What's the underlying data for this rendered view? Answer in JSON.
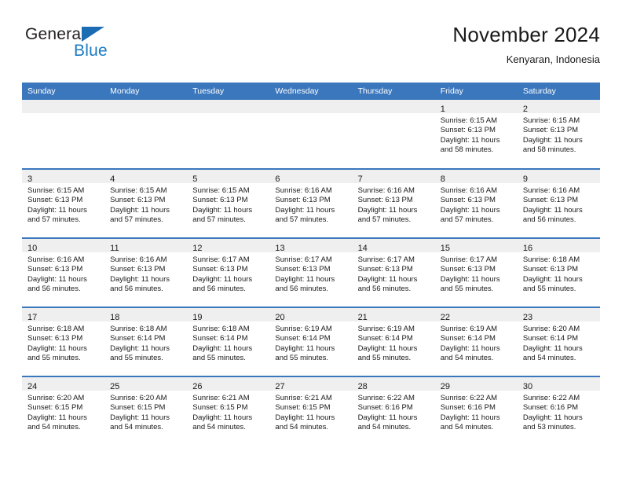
{
  "logo": {
    "word_one": "General",
    "word_two": "Blue",
    "triangle_color": "#1b6cb3",
    "blue_color": "#1b7ac4"
  },
  "header": {
    "title": "November 2024",
    "subtitle": "Kenyaran, Indonesia",
    "accent_color": "#3a77bd",
    "band_color": "#efeff0"
  },
  "calendar": {
    "weekday_headers": [
      "Sunday",
      "Monday",
      "Tuesday",
      "Wednesday",
      "Thursday",
      "Friday",
      "Saturday"
    ],
    "weeks": [
      [
        {
          "day": "",
          "sunrise": "",
          "sunset": "",
          "daylight_1": "",
          "daylight_2": "",
          "empty": true
        },
        {
          "day": "",
          "sunrise": "",
          "sunset": "",
          "daylight_1": "",
          "daylight_2": "",
          "empty": true
        },
        {
          "day": "",
          "sunrise": "",
          "sunset": "",
          "daylight_1": "",
          "daylight_2": "",
          "empty": true
        },
        {
          "day": "",
          "sunrise": "",
          "sunset": "",
          "daylight_1": "",
          "daylight_2": "",
          "empty": true
        },
        {
          "day": "",
          "sunrise": "",
          "sunset": "",
          "daylight_1": "",
          "daylight_2": "",
          "empty": true
        },
        {
          "day": "1",
          "sunrise": "Sunrise: 6:15 AM",
          "sunset": "Sunset: 6:13 PM",
          "daylight_1": "Daylight: 11 hours",
          "daylight_2": "and 58 minutes.",
          "empty": false
        },
        {
          "day": "2",
          "sunrise": "Sunrise: 6:15 AM",
          "sunset": "Sunset: 6:13 PM",
          "daylight_1": "Daylight: 11 hours",
          "daylight_2": "and 58 minutes.",
          "empty": false
        }
      ],
      [
        {
          "day": "3",
          "sunrise": "Sunrise: 6:15 AM",
          "sunset": "Sunset: 6:13 PM",
          "daylight_1": "Daylight: 11 hours",
          "daylight_2": "and 57 minutes.",
          "empty": false
        },
        {
          "day": "4",
          "sunrise": "Sunrise: 6:15 AM",
          "sunset": "Sunset: 6:13 PM",
          "daylight_1": "Daylight: 11 hours",
          "daylight_2": "and 57 minutes.",
          "empty": false
        },
        {
          "day": "5",
          "sunrise": "Sunrise: 6:15 AM",
          "sunset": "Sunset: 6:13 PM",
          "daylight_1": "Daylight: 11 hours",
          "daylight_2": "and 57 minutes.",
          "empty": false
        },
        {
          "day": "6",
          "sunrise": "Sunrise: 6:16 AM",
          "sunset": "Sunset: 6:13 PM",
          "daylight_1": "Daylight: 11 hours",
          "daylight_2": "and 57 minutes.",
          "empty": false
        },
        {
          "day": "7",
          "sunrise": "Sunrise: 6:16 AM",
          "sunset": "Sunset: 6:13 PM",
          "daylight_1": "Daylight: 11 hours",
          "daylight_2": "and 57 minutes.",
          "empty": false
        },
        {
          "day": "8",
          "sunrise": "Sunrise: 6:16 AM",
          "sunset": "Sunset: 6:13 PM",
          "daylight_1": "Daylight: 11 hours",
          "daylight_2": "and 57 minutes.",
          "empty": false
        },
        {
          "day": "9",
          "sunrise": "Sunrise: 6:16 AM",
          "sunset": "Sunset: 6:13 PM",
          "daylight_1": "Daylight: 11 hours",
          "daylight_2": "and 56 minutes.",
          "empty": false
        }
      ],
      [
        {
          "day": "10",
          "sunrise": "Sunrise: 6:16 AM",
          "sunset": "Sunset: 6:13 PM",
          "daylight_1": "Daylight: 11 hours",
          "daylight_2": "and 56 minutes.",
          "empty": false
        },
        {
          "day": "11",
          "sunrise": "Sunrise: 6:16 AM",
          "sunset": "Sunset: 6:13 PM",
          "daylight_1": "Daylight: 11 hours",
          "daylight_2": "and 56 minutes.",
          "empty": false
        },
        {
          "day": "12",
          "sunrise": "Sunrise: 6:17 AM",
          "sunset": "Sunset: 6:13 PM",
          "daylight_1": "Daylight: 11 hours",
          "daylight_2": "and 56 minutes.",
          "empty": false
        },
        {
          "day": "13",
          "sunrise": "Sunrise: 6:17 AM",
          "sunset": "Sunset: 6:13 PM",
          "daylight_1": "Daylight: 11 hours",
          "daylight_2": "and 56 minutes.",
          "empty": false
        },
        {
          "day": "14",
          "sunrise": "Sunrise: 6:17 AM",
          "sunset": "Sunset: 6:13 PM",
          "daylight_1": "Daylight: 11 hours",
          "daylight_2": "and 56 minutes.",
          "empty": false
        },
        {
          "day": "15",
          "sunrise": "Sunrise: 6:17 AM",
          "sunset": "Sunset: 6:13 PM",
          "daylight_1": "Daylight: 11 hours",
          "daylight_2": "and 55 minutes.",
          "empty": false
        },
        {
          "day": "16",
          "sunrise": "Sunrise: 6:18 AM",
          "sunset": "Sunset: 6:13 PM",
          "daylight_1": "Daylight: 11 hours",
          "daylight_2": "and 55 minutes.",
          "empty": false
        }
      ],
      [
        {
          "day": "17",
          "sunrise": "Sunrise: 6:18 AM",
          "sunset": "Sunset: 6:13 PM",
          "daylight_1": "Daylight: 11 hours",
          "daylight_2": "and 55 minutes.",
          "empty": false
        },
        {
          "day": "18",
          "sunrise": "Sunrise: 6:18 AM",
          "sunset": "Sunset: 6:14 PM",
          "daylight_1": "Daylight: 11 hours",
          "daylight_2": "and 55 minutes.",
          "empty": false
        },
        {
          "day": "19",
          "sunrise": "Sunrise: 6:18 AM",
          "sunset": "Sunset: 6:14 PM",
          "daylight_1": "Daylight: 11 hours",
          "daylight_2": "and 55 minutes.",
          "empty": false
        },
        {
          "day": "20",
          "sunrise": "Sunrise: 6:19 AM",
          "sunset": "Sunset: 6:14 PM",
          "daylight_1": "Daylight: 11 hours",
          "daylight_2": "and 55 minutes.",
          "empty": false
        },
        {
          "day": "21",
          "sunrise": "Sunrise: 6:19 AM",
          "sunset": "Sunset: 6:14 PM",
          "daylight_1": "Daylight: 11 hours",
          "daylight_2": "and 55 minutes.",
          "empty": false
        },
        {
          "day": "22",
          "sunrise": "Sunrise: 6:19 AM",
          "sunset": "Sunset: 6:14 PM",
          "daylight_1": "Daylight: 11 hours",
          "daylight_2": "and 54 minutes.",
          "empty": false
        },
        {
          "day": "23",
          "sunrise": "Sunrise: 6:20 AM",
          "sunset": "Sunset: 6:14 PM",
          "daylight_1": "Daylight: 11 hours",
          "daylight_2": "and 54 minutes.",
          "empty": false
        }
      ],
      [
        {
          "day": "24",
          "sunrise": "Sunrise: 6:20 AM",
          "sunset": "Sunset: 6:15 PM",
          "daylight_1": "Daylight: 11 hours",
          "daylight_2": "and 54 minutes.",
          "empty": false
        },
        {
          "day": "25",
          "sunrise": "Sunrise: 6:20 AM",
          "sunset": "Sunset: 6:15 PM",
          "daylight_1": "Daylight: 11 hours",
          "daylight_2": "and 54 minutes.",
          "empty": false
        },
        {
          "day": "26",
          "sunrise": "Sunrise: 6:21 AM",
          "sunset": "Sunset: 6:15 PM",
          "daylight_1": "Daylight: 11 hours",
          "daylight_2": "and 54 minutes.",
          "empty": false
        },
        {
          "day": "27",
          "sunrise": "Sunrise: 6:21 AM",
          "sunset": "Sunset: 6:15 PM",
          "daylight_1": "Daylight: 11 hours",
          "daylight_2": "and 54 minutes.",
          "empty": false
        },
        {
          "day": "28",
          "sunrise": "Sunrise: 6:22 AM",
          "sunset": "Sunset: 6:16 PM",
          "daylight_1": "Daylight: 11 hours",
          "daylight_2": "and 54 minutes.",
          "empty": false
        },
        {
          "day": "29",
          "sunrise": "Sunrise: 6:22 AM",
          "sunset": "Sunset: 6:16 PM",
          "daylight_1": "Daylight: 11 hours",
          "daylight_2": "and 54 minutes.",
          "empty": false
        },
        {
          "day": "30",
          "sunrise": "Sunrise: 6:22 AM",
          "sunset": "Sunset: 6:16 PM",
          "daylight_1": "Daylight: 11 hours",
          "daylight_2": "and 53 minutes.",
          "empty": false
        }
      ]
    ]
  }
}
